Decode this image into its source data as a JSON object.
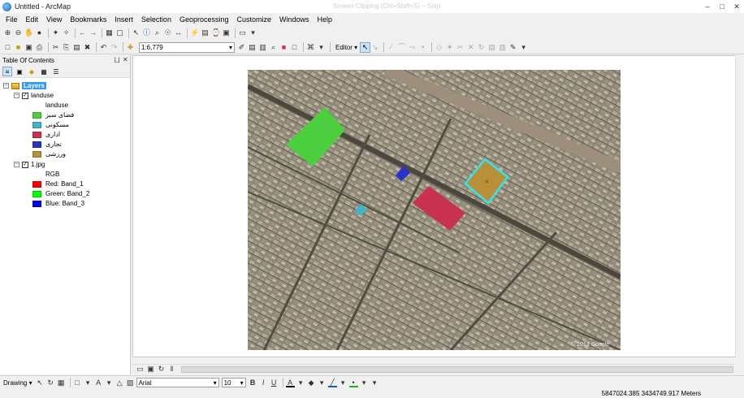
{
  "window": {
    "title": "Untitled - ArcMap",
    "faded_title": "Screen Clipping (Ctrl+Shift+S) – Snip"
  },
  "menu": [
    "File",
    "Edit",
    "View",
    "Bookmarks",
    "Insert",
    "Selection",
    "Geoprocessing",
    "Customize",
    "Windows",
    "Help"
  ],
  "toolbar": {
    "scale_value": "1:6,779",
    "editor_label": "Editor ▾"
  },
  "toc": {
    "title": "Table Of Contents",
    "root_label": "Layers",
    "layer1": {
      "name": "landuse",
      "field": "landuse",
      "classes": [
        {
          "label": "فضای سبز",
          "color": "#4ccf3f"
        },
        {
          "label": "مسکونی",
          "color": "#3fb3c9"
        },
        {
          "label": "اداری",
          "color": "#c8314f"
        },
        {
          "label": "تجاری",
          "color": "#2a33c9"
        },
        {
          "label": "ورزشی",
          "color": "#b98f3a"
        }
      ]
    },
    "layer2": {
      "name": "1.jpg",
      "rgb_label": "RGB",
      "bands": [
        {
          "label": "Red:   Band_1",
          "color": "#ff0000"
        },
        {
          "label": "Green: Band_2",
          "color": "#00ff00"
        },
        {
          "label": "Blue:   Band_3",
          "color": "#0000ff"
        }
      ]
    }
  },
  "drawbar": {
    "drawing_label": "Drawing ▾",
    "font": "Arial",
    "size": "10"
  },
  "status": {
    "coordinates": "5847024.385  3434749.917 Meters"
  },
  "map": {
    "watermark": "© 2013 Google"
  }
}
